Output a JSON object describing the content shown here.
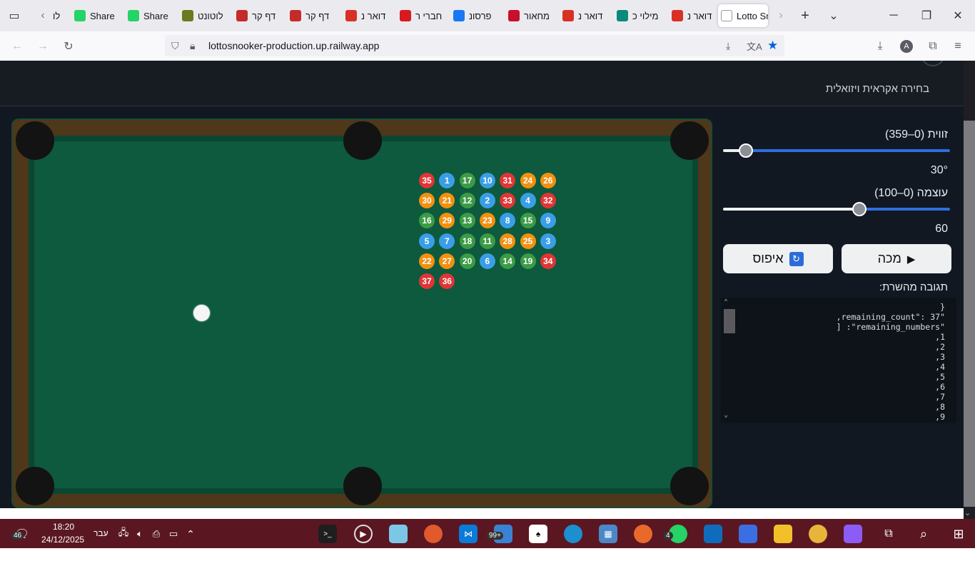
{
  "browser": {
    "tabs": [
      {
        "label": "לו",
        "fav_color": "#7a57b8"
      },
      {
        "label": "Share",
        "fav_color": "#25d366"
      },
      {
        "label": "Share",
        "fav_color": "#25d366"
      },
      {
        "label": "לוטונט",
        "fav_color": "#6b7a1e"
      },
      {
        "label": "דף קר",
        "fav_color": "#c52b2b"
      },
      {
        "label": "דף קר",
        "fav_color": "#c52b2b"
      },
      {
        "label": "דואר נ",
        "fav_color": "#d93025"
      },
      {
        "label": "חברי ר",
        "fav_color": "#d71920"
      },
      {
        "label": "פרסונ",
        "fav_color": "#1877f2"
      },
      {
        "label": "מחאור",
        "fav_color": "#c8102e"
      },
      {
        "label": "דואר נ",
        "fav_color": "#d93025"
      },
      {
        "label": "מילוי כ",
        "fav_color": "#0b8a7a"
      },
      {
        "label": "דואר נ",
        "fav_color": "#d93025"
      },
      {
        "label": "Lotto Sr",
        "fav_color": "#ffffff"
      }
    ],
    "url": "lottosnooker-production.up.railway.app",
    "avatar_letter": "A"
  },
  "page": {
    "subtitle": "בחירה אקראית ויזואלית",
    "angle_label": "זווית (0–359)",
    "angle_value": "30°",
    "angle_fraction": 0.9,
    "power_label": "עוצמה (0–100)",
    "power_value": "60",
    "power_fraction": 0.4,
    "shoot_label": "מכה",
    "reset_label": "איפוס",
    "response_label": "תגובה מהשרת:",
    "response_text": "}\n,remaining_count\": 37\"\n] :\"remaining_numbers\"\n,1\n,2\n,3\n,4\n,5\n,6\n,7\n,8\n,9",
    "colors": {
      "red": "#e03535",
      "blue": "#3a9ee6",
      "green": "#3c9b45",
      "orange": "#f3900f"
    },
    "balls": [
      [
        {
          "n": "35",
          "c": "red"
        },
        {
          "n": "1",
          "c": "blue"
        },
        {
          "n": "17",
          "c": "green"
        },
        {
          "n": "10",
          "c": "blue"
        },
        {
          "n": "31",
          "c": "red"
        },
        {
          "n": "24",
          "c": "orange"
        },
        {
          "n": "26",
          "c": "orange"
        }
      ],
      [
        {
          "n": "30",
          "c": "orange"
        },
        {
          "n": "21",
          "c": "orange"
        },
        {
          "n": "12",
          "c": "green"
        },
        {
          "n": "2",
          "c": "blue"
        },
        {
          "n": "33",
          "c": "red"
        },
        {
          "n": "4",
          "c": "blue"
        },
        {
          "n": "32",
          "c": "red"
        }
      ],
      [
        {
          "n": "16",
          "c": "green"
        },
        {
          "n": "29",
          "c": "orange"
        },
        {
          "n": "13",
          "c": "green"
        },
        {
          "n": "23",
          "c": "orange"
        },
        {
          "n": "8",
          "c": "blue"
        },
        {
          "n": "15",
          "c": "green"
        },
        {
          "n": "9",
          "c": "blue"
        }
      ],
      [
        {
          "n": "5",
          "c": "blue"
        },
        {
          "n": "7",
          "c": "blue"
        },
        {
          "n": "18",
          "c": "green"
        },
        {
          "n": "11",
          "c": "green"
        },
        {
          "n": "28",
          "c": "orange"
        },
        {
          "n": "25",
          "c": "orange"
        },
        {
          "n": "3",
          "c": "blue"
        }
      ],
      [
        {
          "n": "22",
          "c": "orange"
        },
        {
          "n": "27",
          "c": "orange"
        },
        {
          "n": "20",
          "c": "green"
        },
        {
          "n": "6",
          "c": "blue"
        },
        {
          "n": "14",
          "c": "green"
        },
        {
          "n": "19",
          "c": "green"
        },
        {
          "n": "34",
          "c": "red"
        }
      ],
      [
        {
          "n": "37",
          "c": "red"
        },
        {
          "n": "36",
          "c": "red"
        }
      ]
    ]
  },
  "taskbar": {
    "time": "18:20",
    "date": "24/12/2025",
    "lang": "עבר",
    "notif_count": "46",
    "badge_99": "99+",
    "badge_4": "4"
  }
}
